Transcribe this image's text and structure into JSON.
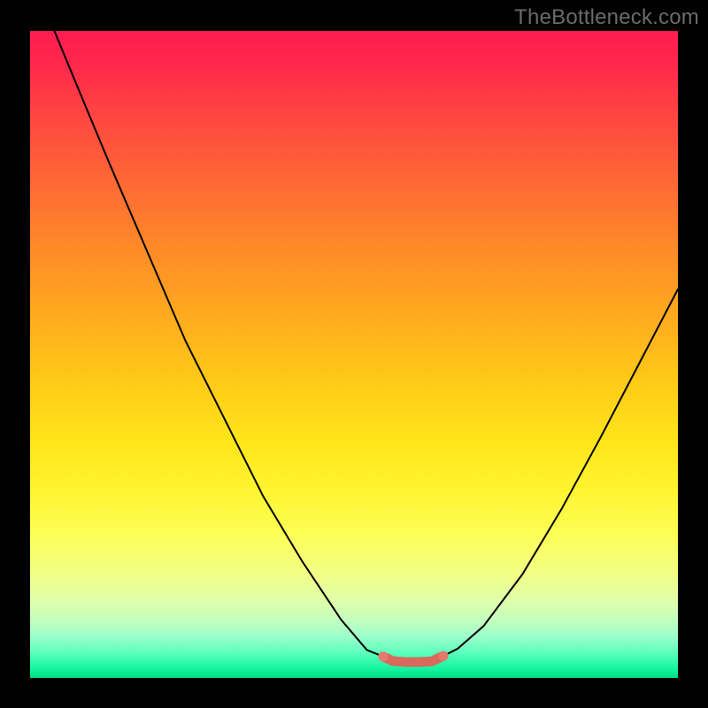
{
  "watermark": "TheBottleneck.com",
  "colors": {
    "frame": "#000000",
    "curve": "#000000",
    "marker": "#d86a5b",
    "marker_alt": "#e57a6c"
  },
  "chart_data": {
    "type": "line",
    "title": "",
    "xlabel": "",
    "ylabel": "",
    "xlim": [
      0,
      100
    ],
    "ylim": [
      0,
      100
    ],
    "grid": false,
    "legend": false,
    "series": [
      {
        "name": "left-curve",
        "x": [
          3.7,
          7,
          12,
          18,
          24,
          30,
          36,
          42,
          48,
          52,
          54.5
        ],
        "y": [
          100,
          92,
          80,
          66,
          52,
          40,
          28,
          18,
          9,
          4.3,
          3.3
        ]
      },
      {
        "name": "right-curve",
        "x": [
          63.8,
          66,
          70,
          76,
          82,
          88,
          94,
          100
        ],
        "y": [
          3.4,
          4.5,
          8,
          16,
          26,
          37,
          48.5,
          60
        ]
      },
      {
        "name": "floor-marker",
        "x": [
          54.5,
          56,
          58,
          60,
          62,
          63.8
        ],
        "y": [
          3.3,
          2.6,
          2.45,
          2.45,
          2.55,
          3.4
        ]
      }
    ],
    "annotations": []
  }
}
